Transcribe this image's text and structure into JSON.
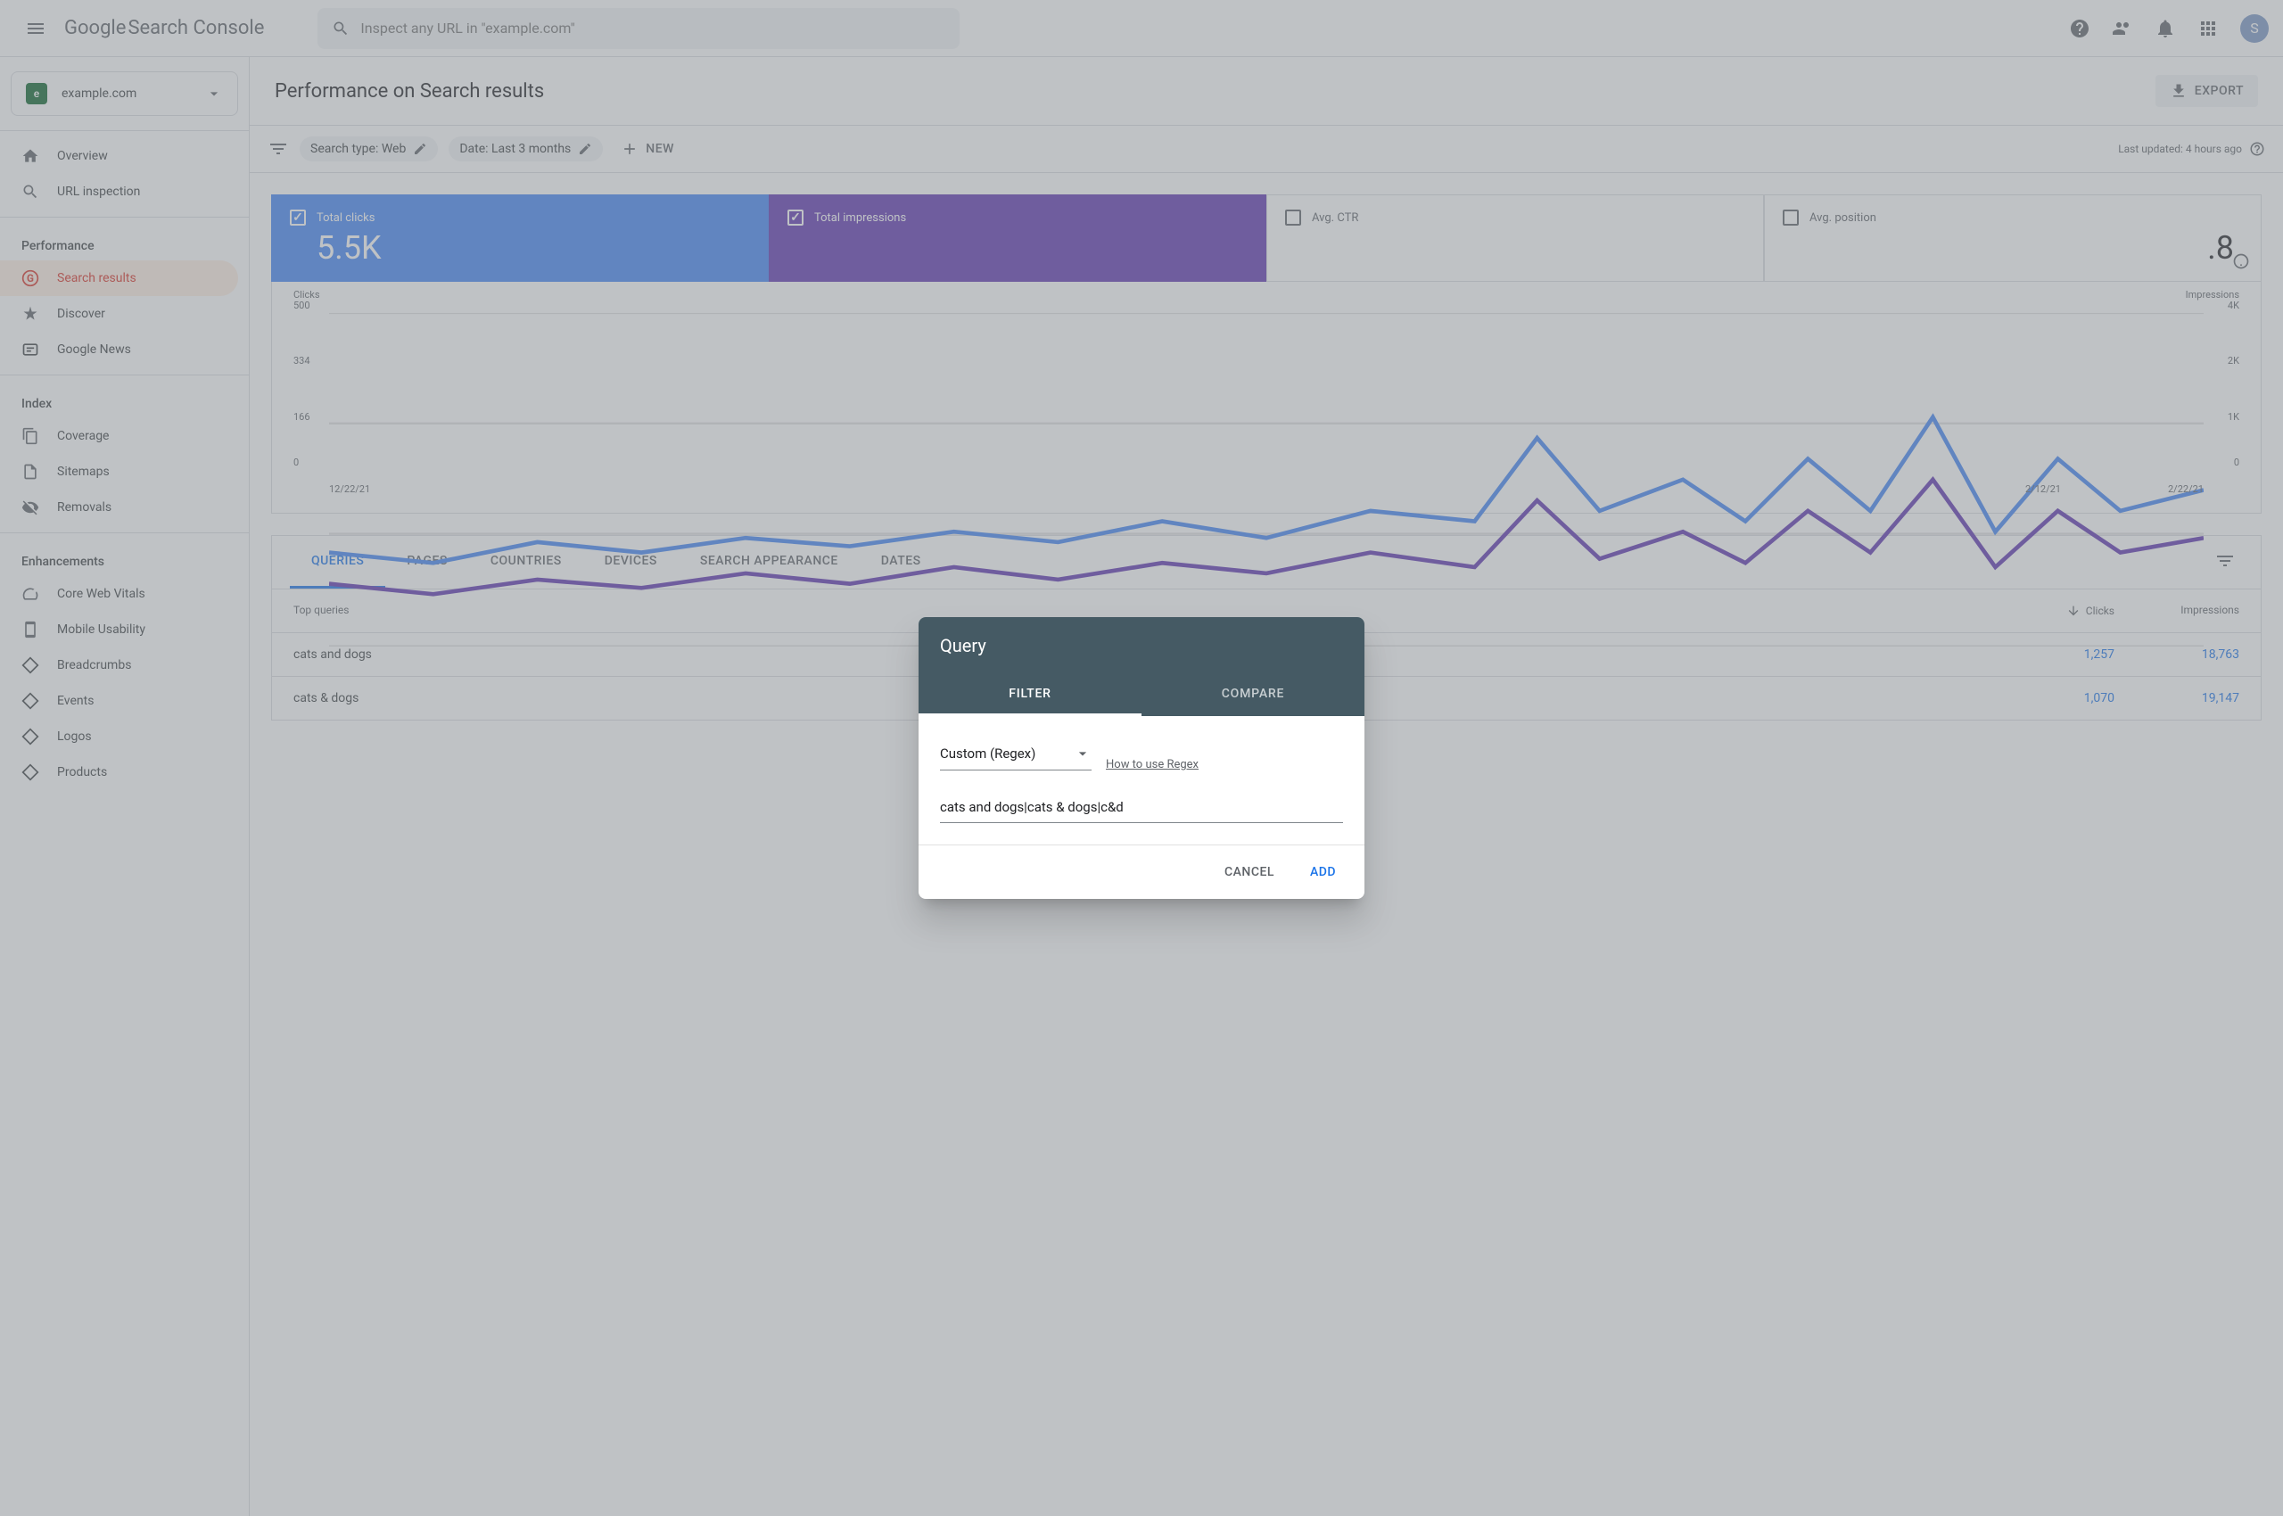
{
  "header": {
    "logo_google": "Google",
    "logo_product": "Search Console",
    "search_placeholder": "Inspect any URL in \"example.com\"",
    "avatar_initial": "S"
  },
  "sidebar": {
    "property_initial": "e",
    "property_name": "example.com",
    "items": {
      "overview": "Overview",
      "url_inspection": "URL inspection",
      "performance_section": "Performance",
      "search_results": "Search results",
      "discover": "Discover",
      "google_news": "Google News",
      "index_section": "Index",
      "coverage": "Coverage",
      "sitemaps": "Sitemaps",
      "removals": "Removals",
      "enhancements_section": "Enhancements",
      "core_web_vitals": "Core Web Vitals",
      "mobile_usability": "Mobile Usability",
      "breadcrumbs": "Breadcrumbs",
      "events": "Events",
      "logos": "Logos",
      "products": "Products"
    }
  },
  "page": {
    "title": "Performance on Search results",
    "export": "EXPORT"
  },
  "filters": {
    "search_type": "Search type: Web",
    "date": "Date: Last 3 months",
    "new": "NEW",
    "last_updated": "Last updated: 4 hours ago"
  },
  "metrics": {
    "clicks_label": "Total clicks",
    "clicks_value": "5.5K",
    "impressions_label": "Total impressions",
    "ctr_label": "Avg. CTR",
    "position_label": "Avg. position",
    "position_value_partial": ".8"
  },
  "chart_data": {
    "type": "line",
    "y_left_title": "Clicks",
    "y_left_ticks": [
      "500",
      "334",
      "166",
      "0"
    ],
    "y_right_title": "Impressions",
    "y_right_ticks": [
      "4K",
      "2K",
      "1K",
      "0"
    ],
    "x_ticks": [
      "12/22/21",
      "2/12/21",
      "2/22/21"
    ],
    "series": [
      {
        "name": "Clicks",
        "color": "#4285f4"
      },
      {
        "name": "Impressions",
        "color": "#5e35b1"
      }
    ]
  },
  "tabs": {
    "queries": "QUERIES",
    "pages": "PAGES",
    "countries": "COUNTRIES",
    "devices": "DEVICES",
    "search_appearance": "SEARCH APPEARANCE",
    "dates": "DATES"
  },
  "table": {
    "header_query": "Top queries",
    "header_clicks": "Clicks",
    "header_impressions": "Impressions",
    "rows": [
      {
        "query": "cats and dogs",
        "clicks": "1,257",
        "impressions": "18,763"
      },
      {
        "query": "cats & dogs",
        "clicks": "1,070",
        "impressions": "19,147"
      }
    ]
  },
  "modal": {
    "title": "Query",
    "tab_filter": "FILTER",
    "tab_compare": "COMPARE",
    "select_value": "Custom (Regex)",
    "regex_help": "How to use Regex",
    "input_value": "cats and dogs|cats & dogs|c&d",
    "cancel": "CANCEL",
    "add": "ADD"
  }
}
